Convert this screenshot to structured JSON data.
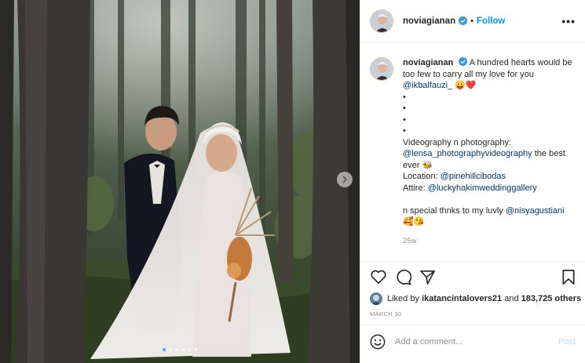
{
  "photo": {
    "alt": "Wedding couple portrait in a forest",
    "carousel": {
      "count": 6,
      "active_index": 0
    }
  },
  "header": {
    "username": "noviagianan",
    "separator": "•",
    "follow_label": "Follow",
    "more_label": "•••",
    "verified": true
  },
  "caption": {
    "username": "noviagianan",
    "lines": [
      {
        "text": "A hundred hearts would be too few to carry all my love for you "
      },
      {
        "mention": "@ikbalfauzi_",
        "emoji": "😛❤️"
      },
      {
        "text": "•"
      },
      {
        "text": "•"
      },
      {
        "text": "•"
      },
      {
        "text": "•"
      },
      {
        "text": "Videography n photography:"
      },
      {
        "mention": "@lensa_photographyvideography",
        "text": " the best ever 🐝"
      },
      {
        "label": "Location: ",
        "mention": "@pinehillcibodas"
      },
      {
        "label": "Attire: ",
        "mention": "@luckyhakimweddinggallery"
      },
      {
        "text": ""
      },
      {
        "label": "n special thnks to my luvly ",
        "mention": "@nisyagustiani"
      },
      {
        "emoji": "🥰😘"
      }
    ],
    "age": "25w"
  },
  "likes": {
    "prefix": "Liked by ",
    "user": "ikatancintalovers21",
    "conjunction": " and ",
    "count": "183,725 others"
  },
  "date": "MARCH 30",
  "comment": {
    "placeholder": "Add a comment...",
    "post_label": "Post"
  },
  "icons": {
    "like": "heart-icon",
    "comment": "comment-bubble-icon",
    "share": "paper-plane-icon",
    "save": "bookmark-icon",
    "emoji": "smiley-icon",
    "next": "chevron-right-icon"
  },
  "colors": {
    "accent": "#0095f6",
    "mention": "#00376b",
    "muted": "#8e8e8e",
    "post_disabled": "#b2dffc"
  }
}
